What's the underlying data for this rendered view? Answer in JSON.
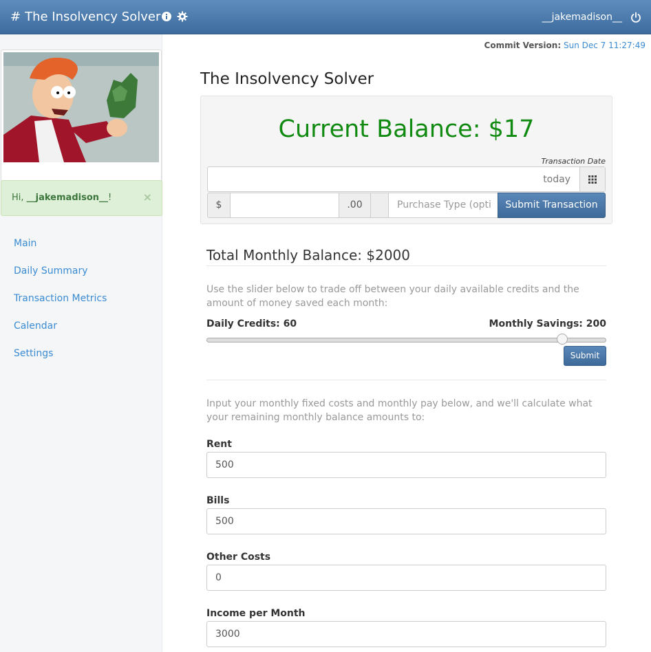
{
  "navbar": {
    "brand_hash": "#",
    "brand_title": "The Insolvency Solver",
    "info_icon": "info-icon",
    "gear_icon": "gear-icon",
    "username": "__jakemadison__",
    "power_icon": "power-icon"
  },
  "sidebar": {
    "greeting_prefix": "Hi, ",
    "greeting_name": "__jakemadison__",
    "greeting_suffix": "!",
    "close_symbol": "×",
    "items": [
      {
        "label": "Main"
      },
      {
        "label": "Daily Summary"
      },
      {
        "label": "Transaction Metrics"
      },
      {
        "label": "Calendar"
      },
      {
        "label": "Settings"
      }
    ]
  },
  "commit": {
    "label": "Commit Version:",
    "value": "Sun Dec 7 11:27:49"
  },
  "main": {
    "title": "The Insolvency Solver",
    "balance_heading": "Current Balance: $17",
    "transaction_date_label": "Transaction Date",
    "date_value": "today",
    "dollar_addon": "$",
    "amount_value": "",
    "cents_addon": ".00",
    "purchase_type_placeholder": "Purchase Type (opti",
    "submit_transaction_label": "Submit Transaction",
    "monthly_heading": "Total Monthly Balance: $2000",
    "slider_help": "Use the slider below to trade off between your daily available credits and the amount of money saved each month:",
    "daily_credits_label": "Daily Credits: 60",
    "monthly_savings_label": "Monthly Savings: 200",
    "slider_value_fraction": 0.9,
    "slider_submit_label": "Submit",
    "fixed_costs_help": "Input your monthly fixed costs and monthly pay below, and we'll calculate what your remaining monthly balance amounts to:",
    "fields": [
      {
        "label": "Rent",
        "value": "500"
      },
      {
        "label": "Bills",
        "value": "500"
      },
      {
        "label": "Other Costs",
        "value": "0"
      },
      {
        "label": "Income per Month",
        "value": "3000"
      }
    ]
  },
  "colors": {
    "navbar": "#4a79ab",
    "balance_green": "#108a10",
    "link_blue": "#3b8bd2",
    "greeting_bg": "#dff0d8"
  }
}
